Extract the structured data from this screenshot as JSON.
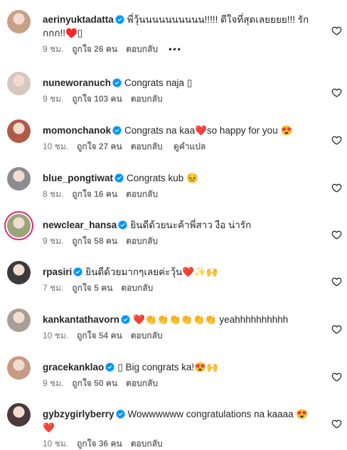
{
  "comments": [
    {
      "username": "aerinyuktadatta",
      "text": "พี่วุ้นนนนนนนนนน!!!!! ดีใจที่สุดเลยยยย!!! รักกกก!!♥️▯",
      "time": "9 ชม.",
      "likes": "ถูกใจ 26 คน",
      "reply": "ตอบกลับ",
      "more": "•••",
      "avatar_color": "#c7a088"
    },
    {
      "username": "nuneworanuch",
      "text": "Congrats naja ▯",
      "time": "9 ชม.",
      "likes": "ถูกใจ 103 คน",
      "reply": "ตอบกลับ",
      "avatar_color": "#d8c6c0"
    },
    {
      "username": "momonchanok",
      "text": "Congrats na kaa❤️so happy for you 😍",
      "time": "10 ชม.",
      "likes": "ถูกใจ 27 คน",
      "reply": "ตอบกลับ",
      "translate": "ดูคำแปล",
      "avatar_color": "#b05a48"
    },
    {
      "username": "blue_pongtiwat",
      "text": "Congrats kub 😣",
      "time": "8 ชม.",
      "likes": "ถูกใจ 16 คน",
      "reply": "ตอบกลับ",
      "avatar_color": "#8c8c90"
    },
    {
      "username": "newclear_hansa",
      "text": "ยินดีด้วยนะค้าพี่สาว งือ น่ารัก",
      "time": "9 ชม.",
      "likes": "ถูกใจ 58 คน",
      "reply": "ตอบกลับ",
      "avatar_color": "#9aa57a"
    },
    {
      "username": "rpasiri",
      "text": "ยินดีด้วยมากๆเลยค่ะวุ้น❤️✨🙌",
      "time": "7 ชม.",
      "likes": "ถูกใจ 5 คน",
      "reply": "ตอบกลับ",
      "avatar_color": "#3a3a3a"
    },
    {
      "username": "kankantathavorn",
      "text": "❤️👏👏👏👏👏👏 yeahhhhhhhhhh",
      "time": "10 ชม.",
      "likes": "ถูกใจ 54 คน",
      "reply": "ตอบกลับ",
      "avatar_color": "#a89e95"
    },
    {
      "username": "gracekanklao",
      "text": "▯ Big congrats ka!😍🙌",
      "time": "9 ชม.",
      "likes": "ถูกใจ 50 คน",
      "reply": "ตอบกลับ",
      "avatar_color": "#c79a86"
    },
    {
      "username": "gybzygirlyberry",
      "text": "Wowwwwww congratulations na kaaaa 😍❤️",
      "time": "10 ชม.",
      "likes": "ถูกใจ 36 คน",
      "reply": "ตอบกลับ",
      "avatar_color": "#4a3a3c"
    }
  ],
  "colors": {
    "verified": "#0095f6",
    "text": "#262626",
    "meta": "#737373"
  },
  "icons": {
    "verified": "verified-badge-icon",
    "like": "heart-outline-icon",
    "avatar": "user-avatar"
  }
}
